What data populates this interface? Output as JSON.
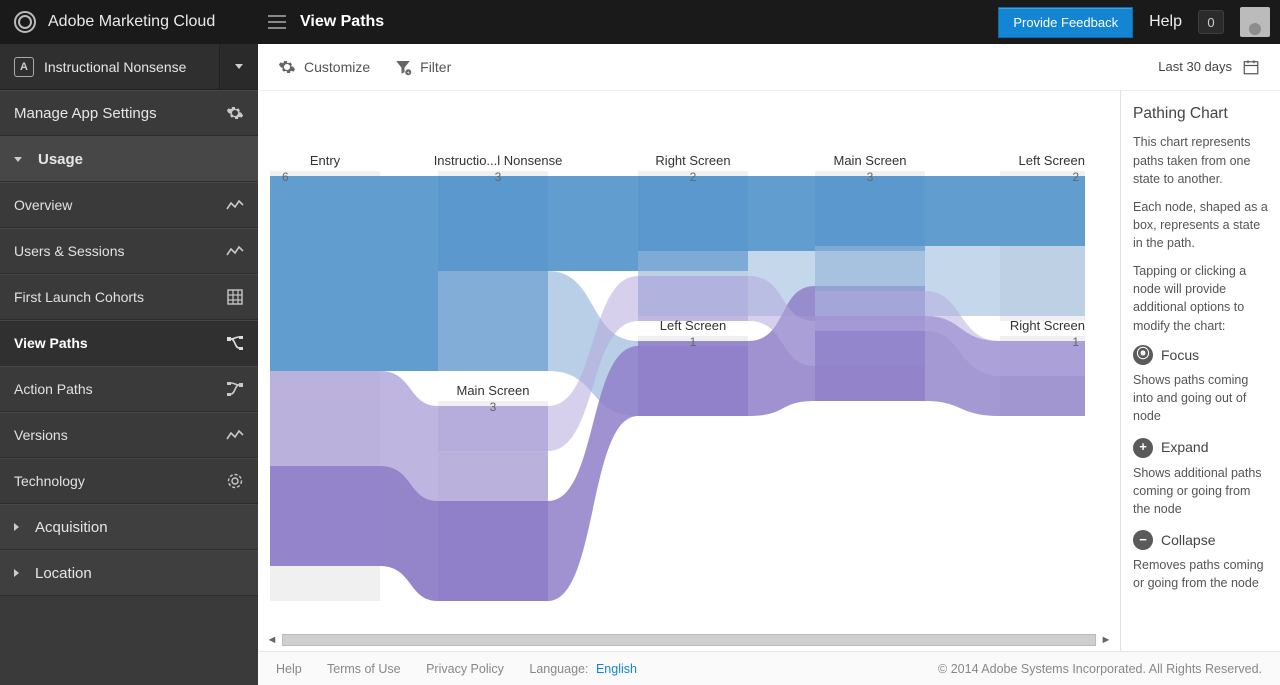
{
  "brand": "Adobe Marketing Cloud",
  "page_title": "View Paths",
  "top": {
    "feedback": "Provide Feedback",
    "help": "Help",
    "notif_count": "0"
  },
  "app_selector": {
    "name": "Instructional Nonsense"
  },
  "sidebar": {
    "manage": "Manage App Settings",
    "usage": "Usage",
    "items": [
      {
        "label": "Overview"
      },
      {
        "label": "Users & Sessions"
      },
      {
        "label": "First Launch Cohorts"
      },
      {
        "label": "View Paths"
      },
      {
        "label": "Action Paths"
      },
      {
        "label": "Versions"
      },
      {
        "label": "Technology"
      }
    ],
    "acquisition": "Acquisition",
    "location": "Location"
  },
  "toolbar": {
    "customize": "Customize",
    "filter": "Filter",
    "daterange": "Last 30 days"
  },
  "info": {
    "title": "Pathing Chart",
    "p1": "This chart represents paths taken from one state to another.",
    "p2": "Each node, shaped as a box, represents a state in the path.",
    "p3": "Tapping or clicking a node will provide additional options to modify the chart:",
    "focus_label": "Focus",
    "focus_desc": "Shows paths coming into and going out of node",
    "expand_label": "Expand",
    "expand_desc": "Shows additional paths coming or going from the node",
    "collapse_label": "Collapse",
    "collapse_desc": "Removes paths coming or going from the node"
  },
  "footer": {
    "help": "Help",
    "terms": "Terms of Use",
    "privacy": "Privacy Policy",
    "language_label": "Language:",
    "language_value": "English",
    "copyright": "© 2014 Adobe Systems Incorporated. All Rights Reserved."
  },
  "chart_data": {
    "type": "sankey",
    "columns": [
      {
        "nodes": [
          {
            "label": "Entry",
            "value": 6
          }
        ]
      },
      {
        "nodes": [
          {
            "label": "Instructio...l Nonsense",
            "value": 3
          },
          {
            "label": "Main Screen",
            "value": 3
          }
        ]
      },
      {
        "nodes": [
          {
            "label": "Right Screen",
            "value": 2
          },
          {
            "label": "Left Screen",
            "value": 1
          }
        ]
      },
      {
        "nodes": [
          {
            "label": "Main Screen",
            "value": 3
          }
        ]
      },
      {
        "nodes": [
          {
            "label": "Left Screen",
            "value": 2
          },
          {
            "label": "Right Screen",
            "value": 1
          }
        ]
      }
    ],
    "links": [
      {
        "from": "Entry",
        "to": "Instructio...l Nonsense",
        "value": 3,
        "color": "#5a98cc"
      },
      {
        "from": "Entry",
        "to": "Main Screen",
        "value": 3,
        "color": "#a395d4"
      },
      {
        "from": "Instructio...l Nonsense",
        "to": "Right Screen",
        "value": 2,
        "color": "#5a98cc"
      },
      {
        "from": "Instructio...l Nonsense",
        "to": "Left Screen",
        "value": 1,
        "color": "#9fb9dc"
      },
      {
        "from": "Main Screen",
        "to": "Right Screen",
        "value": 0,
        "color": "#8f7fc9"
      },
      {
        "from": "Main Screen",
        "to": "Left Screen",
        "value": 0,
        "color": "#b4a9dd"
      },
      {
        "from": "Right Screen",
        "to": "Main Screen",
        "value": 2,
        "color": "#5a98cc"
      },
      {
        "from": "Left Screen",
        "to": "Main Screen",
        "value": 1,
        "color": "#a395d4"
      },
      {
        "from": "Main Screen",
        "to": "Left Screen",
        "value": 2,
        "color": "#8f7fc9"
      },
      {
        "from": "Main Screen",
        "to": "Right Screen",
        "value": 1,
        "color": "#b4a9dd"
      }
    ]
  }
}
